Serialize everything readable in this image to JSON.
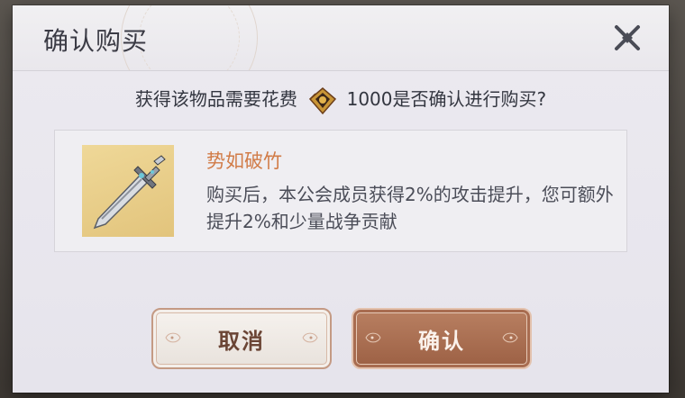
{
  "dialog": {
    "title": "确认购买",
    "question_prefix": "获得该物品需要花费",
    "cost": "1000",
    "question_suffix": "是否确认进行购买?",
    "item": {
      "name": "势如破竹",
      "description": "购买后，本公会成员获得2%的攻击提升，您可额外提升2%和少量战争贡献"
    },
    "buttons": {
      "cancel": "取消",
      "confirm": "确认"
    }
  },
  "icons": {
    "close": "close-icon",
    "currency": "guild-coin-icon",
    "item": "sword-icon"
  },
  "colors": {
    "item_name": "#d17c48",
    "confirm_button": "#a86b4e",
    "cancel_button": "#f2ede8"
  }
}
